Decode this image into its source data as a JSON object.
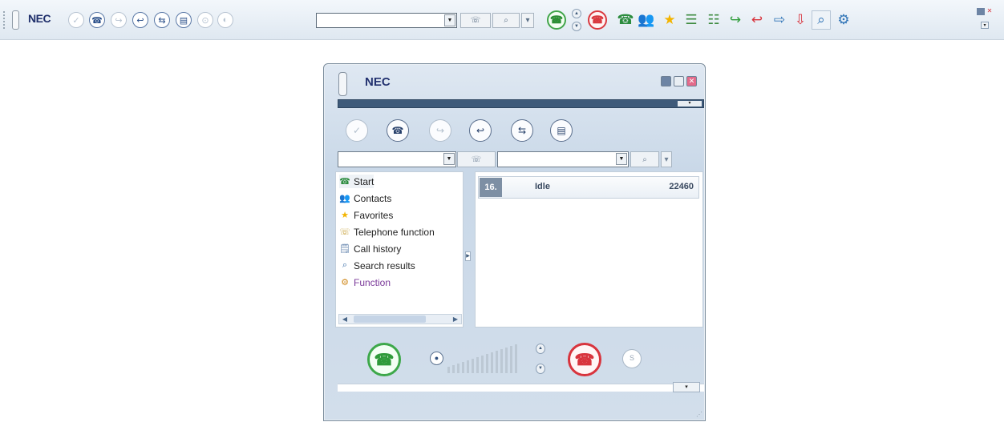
{
  "toolbar": {
    "logo": "NEC",
    "buttons": [
      {
        "icon": "user-check-icon",
        "glyph": "✓",
        "enabled": false
      },
      {
        "icon": "phone-answer-icon",
        "glyph": "☎",
        "enabled": true
      },
      {
        "icon": "phone-forward-icon",
        "glyph": "↪",
        "enabled": false
      },
      {
        "icon": "phone-transfer-icon",
        "glyph": "↩",
        "enabled": true
      },
      {
        "icon": "conference-icon",
        "glyph": "⇆",
        "enabled": true
      },
      {
        "icon": "keypad-icon",
        "glyph": "▤",
        "enabled": true
      },
      {
        "icon": "park-icon",
        "glyph": "⊙",
        "enabled": false
      },
      {
        "icon": "record-icon",
        "glyph": "◐",
        "enabled": false
      }
    ],
    "combo_value": "",
    "dial_label": "",
    "search_label": ""
  },
  "window": {
    "logo": "NEC",
    "line_combo_value": "",
    "search_combo_value": "",
    "tree": [
      {
        "label": "Start",
        "icon": "start-icon",
        "glyph": "☎"
      },
      {
        "label": "Contacts",
        "icon": "contacts-icon",
        "glyph": "👥"
      },
      {
        "label": "Favorites",
        "icon": "star-icon",
        "glyph": "★"
      },
      {
        "label": "Telephone function",
        "icon": "telephone-function-icon",
        "glyph": "☏"
      },
      {
        "label": "Call history",
        "icon": "call-history-icon",
        "glyph": "🗒"
      },
      {
        "label": "Search results",
        "icon": "search-results-icon",
        "glyph": "⌕"
      },
      {
        "label": "Function",
        "icon": "function-icon",
        "glyph": "⚙"
      }
    ],
    "line": {
      "number": "16.",
      "status": "Idle",
      "extension": "22460"
    },
    "transfer_label": "S"
  },
  "colors": {
    "accent": "#3e5a7a",
    "call_green": "#3da84a",
    "hangup_red": "#d8343d",
    "function_purple": "#7b3a9a"
  }
}
